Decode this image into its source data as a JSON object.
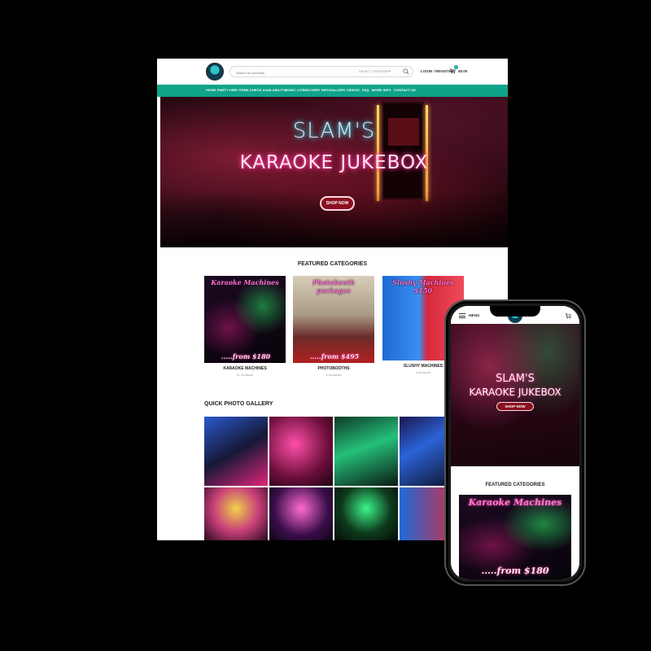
{
  "header": {
    "search_placeholder": "Search for products",
    "select_category": "SELECT CATEGORY",
    "login_label": "LOGIN / REGISTER",
    "cart_count": "0",
    "cart_total": "$0.00"
  },
  "nav": {
    "items": [
      "HOME",
      "PARTY HIRE ITEMS",
      "CHECK AVAILABILITY",
      "MUSIC LIST",
      "DELIVERY INFO",
      "GALLERY",
      "VIDEOS",
      "FAQ",
      "MORE INFO",
      "CONTACT US"
    ]
  },
  "hero": {
    "title_line1": "SLAM'S",
    "title_line2": "KARAOKE JUKEBOX",
    "cta": "SHOP NOW"
  },
  "featured": {
    "heading": "FEATURED CATEGORIES",
    "categories": [
      {
        "image_title": "Karaoke Machines",
        "image_price": ".....from $180",
        "name": "KARAOKE MACHINES",
        "count": "11 products",
        "title_color": "#ff6fd0"
      },
      {
        "image_title": "Photobooth packages",
        "image_price": ".....from $495",
        "name": "PHOTOBOOTHS",
        "count": "6 products",
        "title_color": "#ff6fd0"
      },
      {
        "image_title": "Slushy Machines $150",
        "image_price": "",
        "name": "SLUSHY MACHINES",
        "count": "3 products",
        "title_color": "#ff6fd0"
      }
    ]
  },
  "gallery": {
    "heading": "QUICK PHOTO GALLERY"
  },
  "phone": {
    "menu_label": "MENU",
    "hero_title_line1": "SLAM'S",
    "hero_title_line2": "KARAOKE JUKEBOX",
    "hero_cta": "SHOP NOW",
    "featured_heading": "FEATURED CATEGORIES",
    "card_title": "Karaoke Machines",
    "card_price": ".....from $180"
  },
  "colors": {
    "accent": "#0fa38a",
    "cta": "#8b1020",
    "neon_pink": "#ff3e9c",
    "neon_teal": "#19e2d8"
  }
}
